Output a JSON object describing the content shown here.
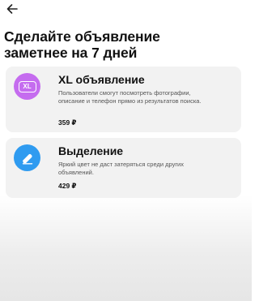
{
  "header": {
    "back_icon": "arrow-left-icon",
    "title_line1": "Сделайте объявление",
    "title_line2": "заметнее на 7 дней"
  },
  "services": [
    {
      "icon": "xl-badge-icon",
      "icon_color": "#c56cef",
      "icon_text": "XL",
      "title": "XL объявление",
      "description": "Пользователи смогут посмотреть фотографии, описание и телефон прямо из результатов поиска.",
      "price": "359 ₽"
    },
    {
      "icon": "eraser-highlight-icon",
      "icon_color": "#2f9bf0",
      "title": "Выделение",
      "description": "Яркий цвет не даст затеряться среди других объявлений.",
      "price": "429 ₽"
    }
  ],
  "colors": {
    "card_background": "#f2f2f2",
    "text": "#111111"
  }
}
